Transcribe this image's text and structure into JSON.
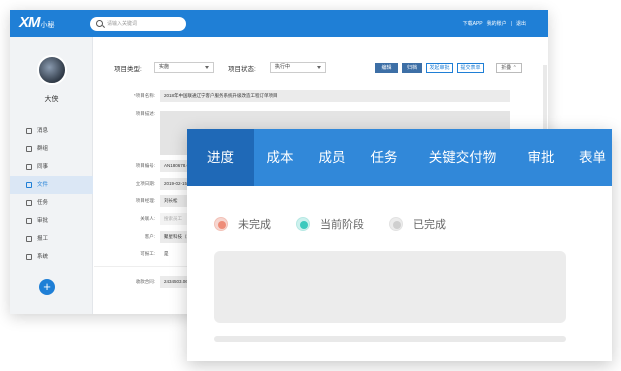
{
  "app": {
    "logo": "XM",
    "logo_sub": "小秘"
  },
  "search": {
    "placeholder": "请输入关键词"
  },
  "top_links": [
    "下载APP",
    "我的账户",
    "|",
    "退出"
  ],
  "user": {
    "name": "大侠"
  },
  "sidebar": {
    "items": [
      {
        "label": "消息",
        "icon": "message-icon"
      },
      {
        "label": "群组",
        "icon": "group-icon"
      },
      {
        "label": "同事",
        "icon": "colleague-icon"
      },
      {
        "label": "文件",
        "icon": "file-icon",
        "active": true
      },
      {
        "label": "任务",
        "icon": "task-icon"
      },
      {
        "label": "审批",
        "icon": "approval-icon"
      },
      {
        "label": "报工",
        "icon": "report-icon"
      },
      {
        "label": "系统",
        "icon": "system-icon"
      }
    ],
    "fab": "+"
  },
  "form": {
    "type_label": "项目类型:",
    "type_value": "实施",
    "status_label": "项目状态:",
    "status_value": "执行中",
    "actions": [
      "编辑",
      "归档",
      "发起审批",
      "提交表单",
      "折叠"
    ],
    "rows": {
      "name_label": "*项目名称:",
      "name_value": "2018年中国联通辽宁客户服务系统升级改造工程订单项目",
      "desc_label": "项目描述:",
      "code_label": "项目编号:",
      "code_value": "AN180678.C",
      "date_label": "立项日期:",
      "date_value": "2019-02-15",
      "manager_label": "项目经理:",
      "manager_value": "刘长松",
      "related_label": "关联人:",
      "related_value": "搜索员工",
      "customer_label": "客户:",
      "customer_value": "聚星科技（北京）",
      "billing_label": "可报工:",
      "billing_value": "是",
      "amount_label": "收款合同:",
      "amount_value": "2434503.06元"
    }
  },
  "card": {
    "tabs": [
      "进度",
      "成本",
      "成员",
      "任务",
      "关键交付物",
      "审批",
      "表单"
    ],
    "active_tab": 0,
    "legend": [
      "未完成",
      "当前阶段",
      "已完成"
    ],
    "colors": {
      "incomplete": "#ee8c78",
      "current": "#3cc9bd",
      "done": "#cfcfcf",
      "accent": "#3188d9"
    }
  }
}
